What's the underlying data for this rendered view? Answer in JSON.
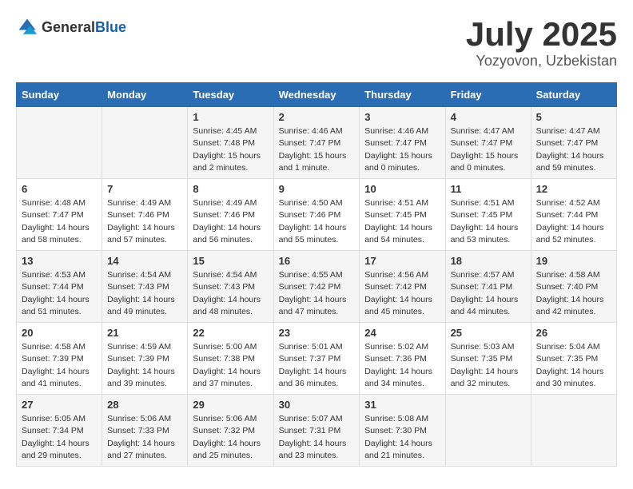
{
  "logo": {
    "general": "General",
    "blue": "Blue"
  },
  "title": "July 2025",
  "location": "Yozyovon, Uzbekistan",
  "headers": [
    "Sunday",
    "Monday",
    "Tuesday",
    "Wednesday",
    "Thursday",
    "Friday",
    "Saturday"
  ],
  "weeks": [
    [
      {
        "day": "",
        "info": ""
      },
      {
        "day": "",
        "info": ""
      },
      {
        "day": "1",
        "info": "Sunrise: 4:45 AM\nSunset: 7:48 PM\nDaylight: 15 hours\nand 2 minutes."
      },
      {
        "day": "2",
        "info": "Sunrise: 4:46 AM\nSunset: 7:47 PM\nDaylight: 15 hours\nand 1 minute."
      },
      {
        "day": "3",
        "info": "Sunrise: 4:46 AM\nSunset: 7:47 PM\nDaylight: 15 hours\nand 0 minutes."
      },
      {
        "day": "4",
        "info": "Sunrise: 4:47 AM\nSunset: 7:47 PM\nDaylight: 15 hours\nand 0 minutes."
      },
      {
        "day": "5",
        "info": "Sunrise: 4:47 AM\nSunset: 7:47 PM\nDaylight: 14 hours\nand 59 minutes."
      }
    ],
    [
      {
        "day": "6",
        "info": "Sunrise: 4:48 AM\nSunset: 7:47 PM\nDaylight: 14 hours\nand 58 minutes."
      },
      {
        "day": "7",
        "info": "Sunrise: 4:49 AM\nSunset: 7:46 PM\nDaylight: 14 hours\nand 57 minutes."
      },
      {
        "day": "8",
        "info": "Sunrise: 4:49 AM\nSunset: 7:46 PM\nDaylight: 14 hours\nand 56 minutes."
      },
      {
        "day": "9",
        "info": "Sunrise: 4:50 AM\nSunset: 7:46 PM\nDaylight: 14 hours\nand 55 minutes."
      },
      {
        "day": "10",
        "info": "Sunrise: 4:51 AM\nSunset: 7:45 PM\nDaylight: 14 hours\nand 54 minutes."
      },
      {
        "day": "11",
        "info": "Sunrise: 4:51 AM\nSunset: 7:45 PM\nDaylight: 14 hours\nand 53 minutes."
      },
      {
        "day": "12",
        "info": "Sunrise: 4:52 AM\nSunset: 7:44 PM\nDaylight: 14 hours\nand 52 minutes."
      }
    ],
    [
      {
        "day": "13",
        "info": "Sunrise: 4:53 AM\nSunset: 7:44 PM\nDaylight: 14 hours\nand 51 minutes."
      },
      {
        "day": "14",
        "info": "Sunrise: 4:54 AM\nSunset: 7:43 PM\nDaylight: 14 hours\nand 49 minutes."
      },
      {
        "day": "15",
        "info": "Sunrise: 4:54 AM\nSunset: 7:43 PM\nDaylight: 14 hours\nand 48 minutes."
      },
      {
        "day": "16",
        "info": "Sunrise: 4:55 AM\nSunset: 7:42 PM\nDaylight: 14 hours\nand 47 minutes."
      },
      {
        "day": "17",
        "info": "Sunrise: 4:56 AM\nSunset: 7:42 PM\nDaylight: 14 hours\nand 45 minutes."
      },
      {
        "day": "18",
        "info": "Sunrise: 4:57 AM\nSunset: 7:41 PM\nDaylight: 14 hours\nand 44 minutes."
      },
      {
        "day": "19",
        "info": "Sunrise: 4:58 AM\nSunset: 7:40 PM\nDaylight: 14 hours\nand 42 minutes."
      }
    ],
    [
      {
        "day": "20",
        "info": "Sunrise: 4:58 AM\nSunset: 7:39 PM\nDaylight: 14 hours\nand 41 minutes."
      },
      {
        "day": "21",
        "info": "Sunrise: 4:59 AM\nSunset: 7:39 PM\nDaylight: 14 hours\nand 39 minutes."
      },
      {
        "day": "22",
        "info": "Sunrise: 5:00 AM\nSunset: 7:38 PM\nDaylight: 14 hours\nand 37 minutes."
      },
      {
        "day": "23",
        "info": "Sunrise: 5:01 AM\nSunset: 7:37 PM\nDaylight: 14 hours\nand 36 minutes."
      },
      {
        "day": "24",
        "info": "Sunrise: 5:02 AM\nSunset: 7:36 PM\nDaylight: 14 hours\nand 34 minutes."
      },
      {
        "day": "25",
        "info": "Sunrise: 5:03 AM\nSunset: 7:35 PM\nDaylight: 14 hours\nand 32 minutes."
      },
      {
        "day": "26",
        "info": "Sunrise: 5:04 AM\nSunset: 7:35 PM\nDaylight: 14 hours\nand 30 minutes."
      }
    ],
    [
      {
        "day": "27",
        "info": "Sunrise: 5:05 AM\nSunset: 7:34 PM\nDaylight: 14 hours\nand 29 minutes."
      },
      {
        "day": "28",
        "info": "Sunrise: 5:06 AM\nSunset: 7:33 PM\nDaylight: 14 hours\nand 27 minutes."
      },
      {
        "day": "29",
        "info": "Sunrise: 5:06 AM\nSunset: 7:32 PM\nDaylight: 14 hours\nand 25 minutes."
      },
      {
        "day": "30",
        "info": "Sunrise: 5:07 AM\nSunset: 7:31 PM\nDaylight: 14 hours\nand 23 minutes."
      },
      {
        "day": "31",
        "info": "Sunrise: 5:08 AM\nSunset: 7:30 PM\nDaylight: 14 hours\nand 21 minutes."
      },
      {
        "day": "",
        "info": ""
      },
      {
        "day": "",
        "info": ""
      }
    ]
  ]
}
